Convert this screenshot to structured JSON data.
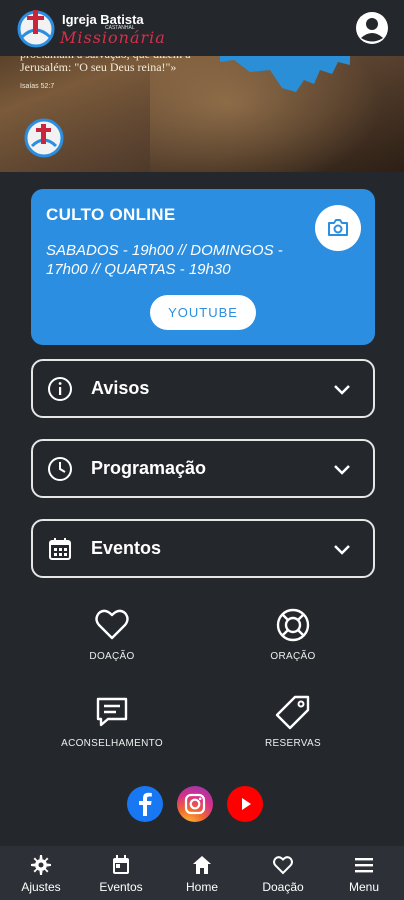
{
  "header": {
    "church_name": "Igreja Batista",
    "church_subtitle": "CASTANHAL",
    "church_script": "Missionária",
    "account_icon": "account-circle-icon"
  },
  "hero": {
    "verse": "proclamam a salvação, que dizem a Jerusalém: \"O seu Deus reina!\"»",
    "reference": "Isaías 52:7"
  },
  "culto": {
    "title": "CULTO ONLINE",
    "schedule": "SABADOS - 19h00 // DOMINGOS - 17h00 // QUARTAS - 19h30",
    "button_label": "YOUTUBE",
    "camera_icon": "camera-icon",
    "color": "#2b8ee0"
  },
  "accordions": [
    {
      "label": "Avisos",
      "icon": "info-icon"
    },
    {
      "label": "Programação",
      "icon": "clock-icon"
    },
    {
      "label": "Eventos",
      "icon": "calendar-icon"
    }
  ],
  "tiles": [
    {
      "label": "DOAÇÃO",
      "icon": "heart-icon"
    },
    {
      "label": "ORAÇÃO",
      "icon": "lifebuoy-icon"
    },
    {
      "label": "ACONSELHAMENTO",
      "icon": "chat-icon"
    },
    {
      "label": "RESERVAS",
      "icon": "tag-icon"
    }
  ],
  "social": [
    {
      "name": "facebook-icon",
      "color": "#1877f2"
    },
    {
      "name": "instagram-icon",
      "color": "#d6308a"
    },
    {
      "name": "youtube-icon",
      "color": "#ff0000"
    }
  ],
  "bottom_nav": [
    {
      "label": "Ajustes",
      "icon": "gear-icon"
    },
    {
      "label": "Eventos",
      "icon": "calendar-icon"
    },
    {
      "label": "Home",
      "icon": "home-icon"
    },
    {
      "label": "Doação",
      "icon": "heart-icon"
    },
    {
      "label": "Menu",
      "icon": "hamburger-icon"
    }
  ]
}
